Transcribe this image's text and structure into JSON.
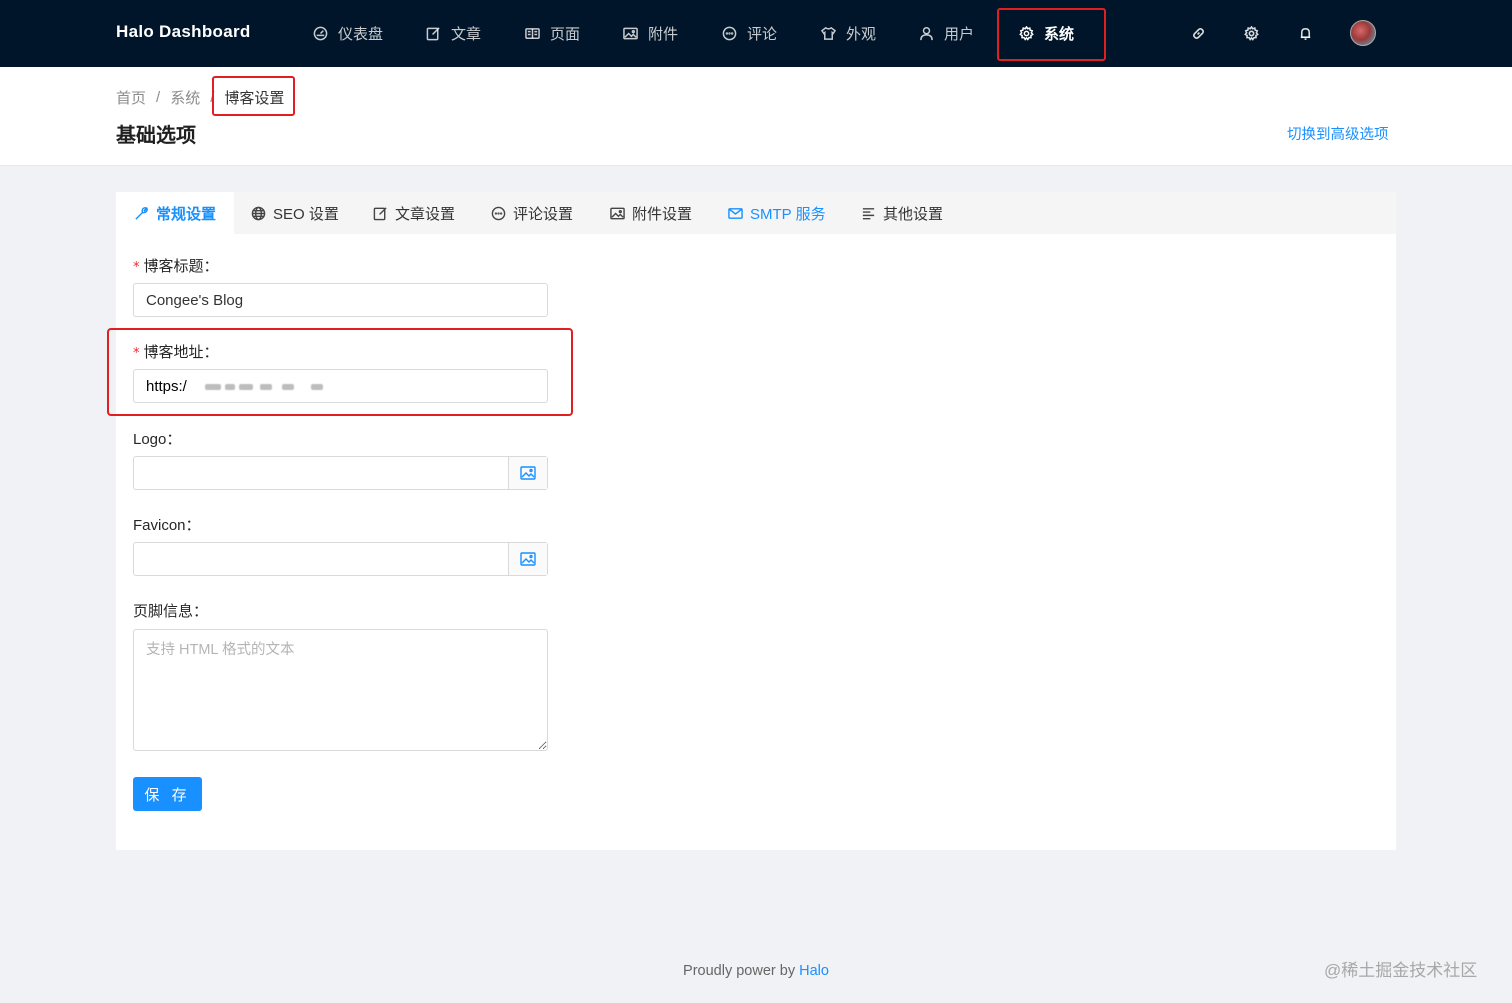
{
  "navbar": {
    "brand": "Halo  Dashboard",
    "items": [
      {
        "label": "仪表盘",
        "icon": "dashboard-icon"
      },
      {
        "label": "文章",
        "icon": "edit-icon"
      },
      {
        "label": "页面",
        "icon": "read-icon"
      },
      {
        "label": "附件",
        "icon": "picture-icon"
      },
      {
        "label": "评论",
        "icon": "message-icon"
      },
      {
        "label": "外观",
        "icon": "skin-icon"
      },
      {
        "label": "用户",
        "icon": "user-icon"
      },
      {
        "label": "系统",
        "icon": "setting-icon",
        "active": true
      }
    ],
    "tools": [
      "link-icon",
      "setting-icon",
      "bell-icon",
      "avatar"
    ]
  },
  "breadcrumb": {
    "items": [
      "首页",
      "系统",
      "博客设置"
    ],
    "separator": "/"
  },
  "header": {
    "title": "基础选项",
    "switch_link": "切换到高级选项"
  },
  "tabs": [
    {
      "label": "常规设置",
      "icon": "tool-icon",
      "active": true
    },
    {
      "label": "SEO 设置",
      "icon": "global-icon"
    },
    {
      "label": "文章设置",
      "icon": "form-icon"
    },
    {
      "label": "评论设置",
      "icon": "message-icon"
    },
    {
      "label": "附件设置",
      "icon": "picture-icon"
    },
    {
      "label": "SMTP 服务",
      "icon": "mail-icon",
      "highlight": true
    },
    {
      "label": "其他设置",
      "icon": "align-left-icon"
    }
  ],
  "form": {
    "blog_title": {
      "label": "博客标题：",
      "required": true,
      "value": "Congee's Blog"
    },
    "blog_url": {
      "label": "博客地址：",
      "required": true,
      "value": "https:/"
    },
    "logo": {
      "label": "Logo：",
      "value": ""
    },
    "favicon": {
      "label": "Favicon：",
      "value": ""
    },
    "footer_info": {
      "label": "页脚信息：",
      "placeholder": "支持 HTML 格式的文本"
    },
    "save_label": "保 存"
  },
  "footer": {
    "text": "Proudly power by ",
    "link": "Halo"
  },
  "watermark": "@稀土掘金技术社区",
  "colors": {
    "nav_bg": "#001529",
    "accent": "#1890ff",
    "highlight_box": "#e02020",
    "required": "#f5222d"
  }
}
